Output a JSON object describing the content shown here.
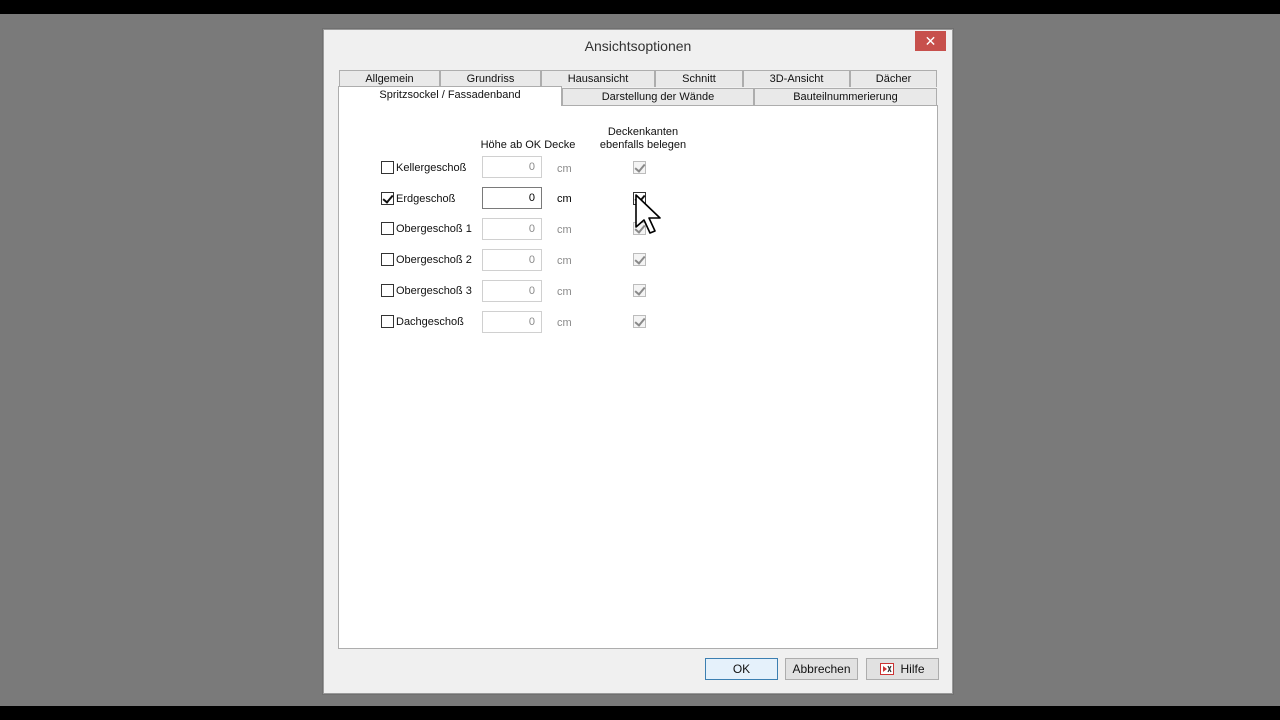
{
  "window": {
    "title": "Ansichtsoptionen",
    "close_symbol": "✕"
  },
  "tabs_row1": [
    "Allgemein",
    "Grundriss",
    "Hausansicht",
    "Schnitt",
    "3D-Ansicht",
    "Dächer"
  ],
  "tabs_row2": [
    "Spritzsockel / Fassadenband",
    "Darstellung der Wände",
    "Bauteilnummerierung"
  ],
  "active_tab": "Spritzsockel / Fassadenband",
  "columns": {
    "height_header": "Höhe ab OK Decke",
    "edges_header_line1": "Deckenkanten",
    "edges_header_line2": "ebenfalls belegen"
  },
  "rows": [
    {
      "label": "Kellergeschoß",
      "checked": false,
      "value": "0",
      "unit": "cm",
      "edges_checked": true
    },
    {
      "label": "Erdgeschoß",
      "checked": true,
      "value": "0",
      "unit": "cm",
      "edges_checked": true
    },
    {
      "label": "Obergeschoß 1",
      "checked": false,
      "value": "0",
      "unit": "cm",
      "edges_checked": true
    },
    {
      "label": "Obergeschoß 2",
      "checked": false,
      "value": "0",
      "unit": "cm",
      "edges_checked": true
    },
    {
      "label": "Obergeschoß 3",
      "checked": false,
      "value": "0",
      "unit": "cm",
      "edges_checked": true
    },
    {
      "label": "Dachgeschoß",
      "checked": false,
      "value": "0",
      "unit": "cm",
      "edges_checked": true
    }
  ],
  "buttons": {
    "ok": "OK",
    "cancel": "Abbrechen",
    "help": "Hilfe"
  },
  "icons": {
    "close": "close-icon",
    "help": "help-icon",
    "cursor": "mouse-pointer-icon"
  },
  "colors": {
    "close_button": "#c7504c",
    "primary_border": "#3c7fb1",
    "background": "#7a7a7a"
  }
}
